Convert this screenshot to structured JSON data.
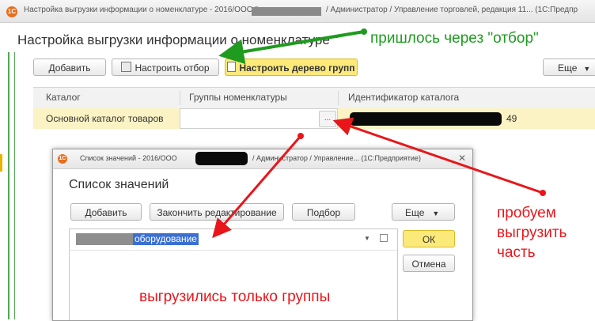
{
  "main_window": {
    "titlebar": "Настройка выгрузки информации о номенклатуре - 2016/ООО \"",
    "titlebar_right": "/ Администратор / Управление торговлей, редакция 11...  (1С:Предпр",
    "form_title": "Настройка выгрузки информации о номенклатуре \"",
    "buttons": {
      "add": "Добавить",
      "setup_filter": "Настроить отбор",
      "setup_tree": "Настроить дерево групп",
      "more": "Еще"
    },
    "table": {
      "columns": [
        "Каталог",
        "Группы номенклатуры",
        "Идентификатор каталога"
      ],
      "rows": [
        {
          "catalog": "Основной каталог товаров",
          "groups": "",
          "groups_button": "...",
          "id_suffix": "49"
        }
      ]
    }
  },
  "dialog": {
    "titlebar": "Список значений - 2016/ООО",
    "titlebar_right": "/ Администратор / Управление... (1С:Предприятие)",
    "close": "✕",
    "form_title": "Список значений",
    "buttons": {
      "add": "Добавить",
      "finish_edit": "Закончить редактирование",
      "pick": "Подбор",
      "more": "Еще",
      "ok": "ОК",
      "cancel": "Отмена"
    },
    "list_item_text": "оборудование"
  },
  "annotations": {
    "green_note": "пришлось через \"отбор\"",
    "red_note_line1": "пробуем",
    "red_note_line2": "выгрузить",
    "red_note_line3": "часть",
    "red_bottom_note": "выгрузились только группы"
  },
  "colors": {
    "accent_yellow": "#fbe979",
    "highlight_row": "#fbf3c4",
    "annotation_red": "#e8161b",
    "annotation_green": "#1f9b1f",
    "selection_blue": "#3b6fd1"
  }
}
